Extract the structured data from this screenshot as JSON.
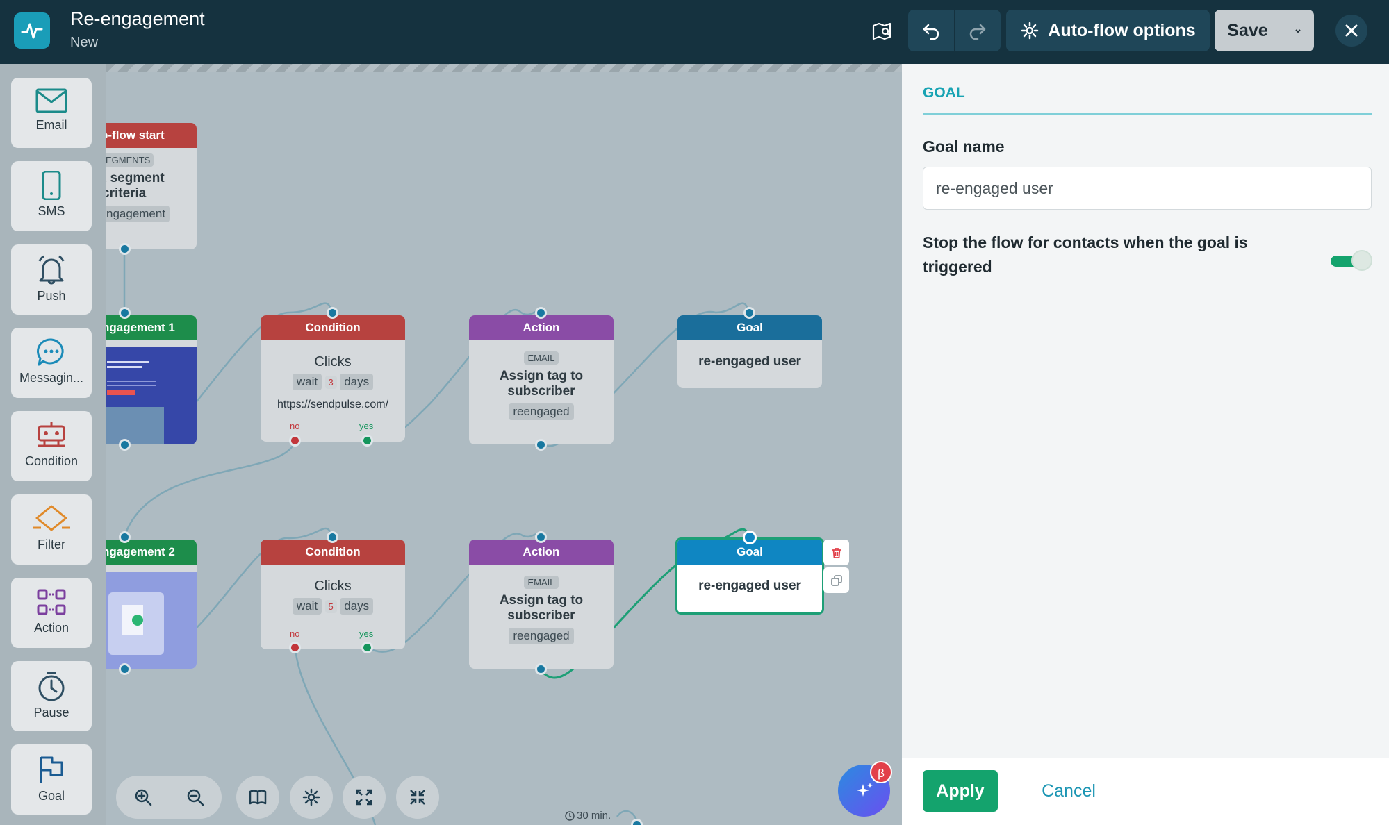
{
  "header": {
    "title": "Re-engagement",
    "subtitle": "New",
    "auto_flow_label": "Auto-flow options",
    "save_label": "Save"
  },
  "toolbox": {
    "items": [
      {
        "label": "Email",
        "icon": "envelope-icon"
      },
      {
        "label": "SMS",
        "icon": "phone-icon"
      },
      {
        "label": "Push",
        "icon": "bell-icon"
      },
      {
        "label": "Messagin...",
        "icon": "chat-icon"
      },
      {
        "label": "Condition",
        "icon": "condition-icon"
      },
      {
        "label": "Filter",
        "icon": "filter-icon"
      },
      {
        "label": "Action",
        "icon": "action-icon"
      },
      {
        "label": "Pause",
        "icon": "stopwatch-icon"
      },
      {
        "label": "Goal",
        "icon": "flag-icon"
      }
    ]
  },
  "canvas": {
    "start_node": {
      "title": "o-flow start",
      "tag": "EGMENTS",
      "line1": "t segment",
      "line2": "criteria",
      "chip": "ngagement"
    },
    "email1": {
      "title": "ngagement 1"
    },
    "email2": {
      "title": "ngagement 2"
    },
    "condition1": {
      "title": "Condition",
      "main": "Clicks",
      "wait": "wait",
      "num": "3",
      "unit": "days",
      "url": "https://sendpulse.com/",
      "no": "no",
      "yes": "yes"
    },
    "condition2": {
      "title": "Condition",
      "main": "Clicks",
      "wait": "wait",
      "num": "5",
      "unit": "days",
      "no": "no",
      "yes": "yes"
    },
    "action1": {
      "title": "Action",
      "tag": "EMAIL",
      "line1": "Assign tag to",
      "line2": "subscriber",
      "chip": "reengaged"
    },
    "action2": {
      "title": "Action",
      "tag": "EMAIL",
      "line1": "Assign tag to",
      "line2": "subscriber",
      "chip": "reengaged"
    },
    "goal1": {
      "title": "Goal",
      "text": "re-engaged user"
    },
    "goal2": {
      "title": "Goal",
      "text": "re-engaged user"
    },
    "pause_label": "30 min."
  },
  "panel": {
    "section": "GOAL",
    "goal_name_label": "Goal name",
    "goal_name_value": "re-engaged user",
    "stop_label": "Stop the flow for contacts when the goal is triggered",
    "stop_enabled": true,
    "apply_label": "Apply",
    "cancel_label": "Cancel"
  },
  "ai_badge": "β",
  "colors": {
    "condition": "#b7423f",
    "action": "#8a4ca6",
    "goal": "#1a6e9b",
    "email": "#1d8d4b",
    "accent": "#14a36d",
    "header_bg": "#15323f"
  }
}
